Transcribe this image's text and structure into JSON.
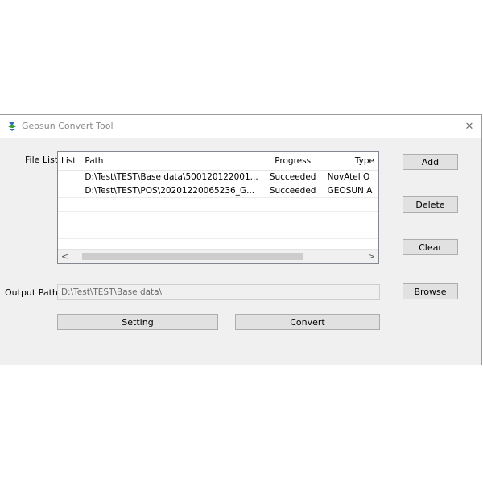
{
  "window": {
    "title": "Geosun Convert Tool",
    "close_glyph": "✕"
  },
  "file_list": {
    "label": "File List",
    "columns": [
      "List",
      "Path",
      "Progress",
      "Type"
    ],
    "rows": [
      {
        "list": "",
        "path": "D:\\Test\\TEST\\Base data\\500120122001...",
        "progress": "Succeeded",
        "type": "NovAtel O"
      },
      {
        "list": "",
        "path": "D:\\Test\\TEST\\POS\\20201220065236_G...",
        "progress": "Succeeded",
        "type": "GEOSUN A"
      }
    ],
    "scroll_left": "<",
    "scroll_right": ">"
  },
  "buttons": {
    "add": "Add",
    "delete": "Delete",
    "clear": "Clear",
    "browse": "Browse",
    "setting": "Setting",
    "convert": "Convert"
  },
  "output": {
    "label": "Output Path",
    "value": "D:\\Test\\TEST\\Base data\\"
  },
  "colors": {
    "window_bg": "#f0f0f0",
    "button_bg": "#e1e1e1",
    "icon_green": "#3a9a3a",
    "icon_blue": "#2f6fbf"
  }
}
